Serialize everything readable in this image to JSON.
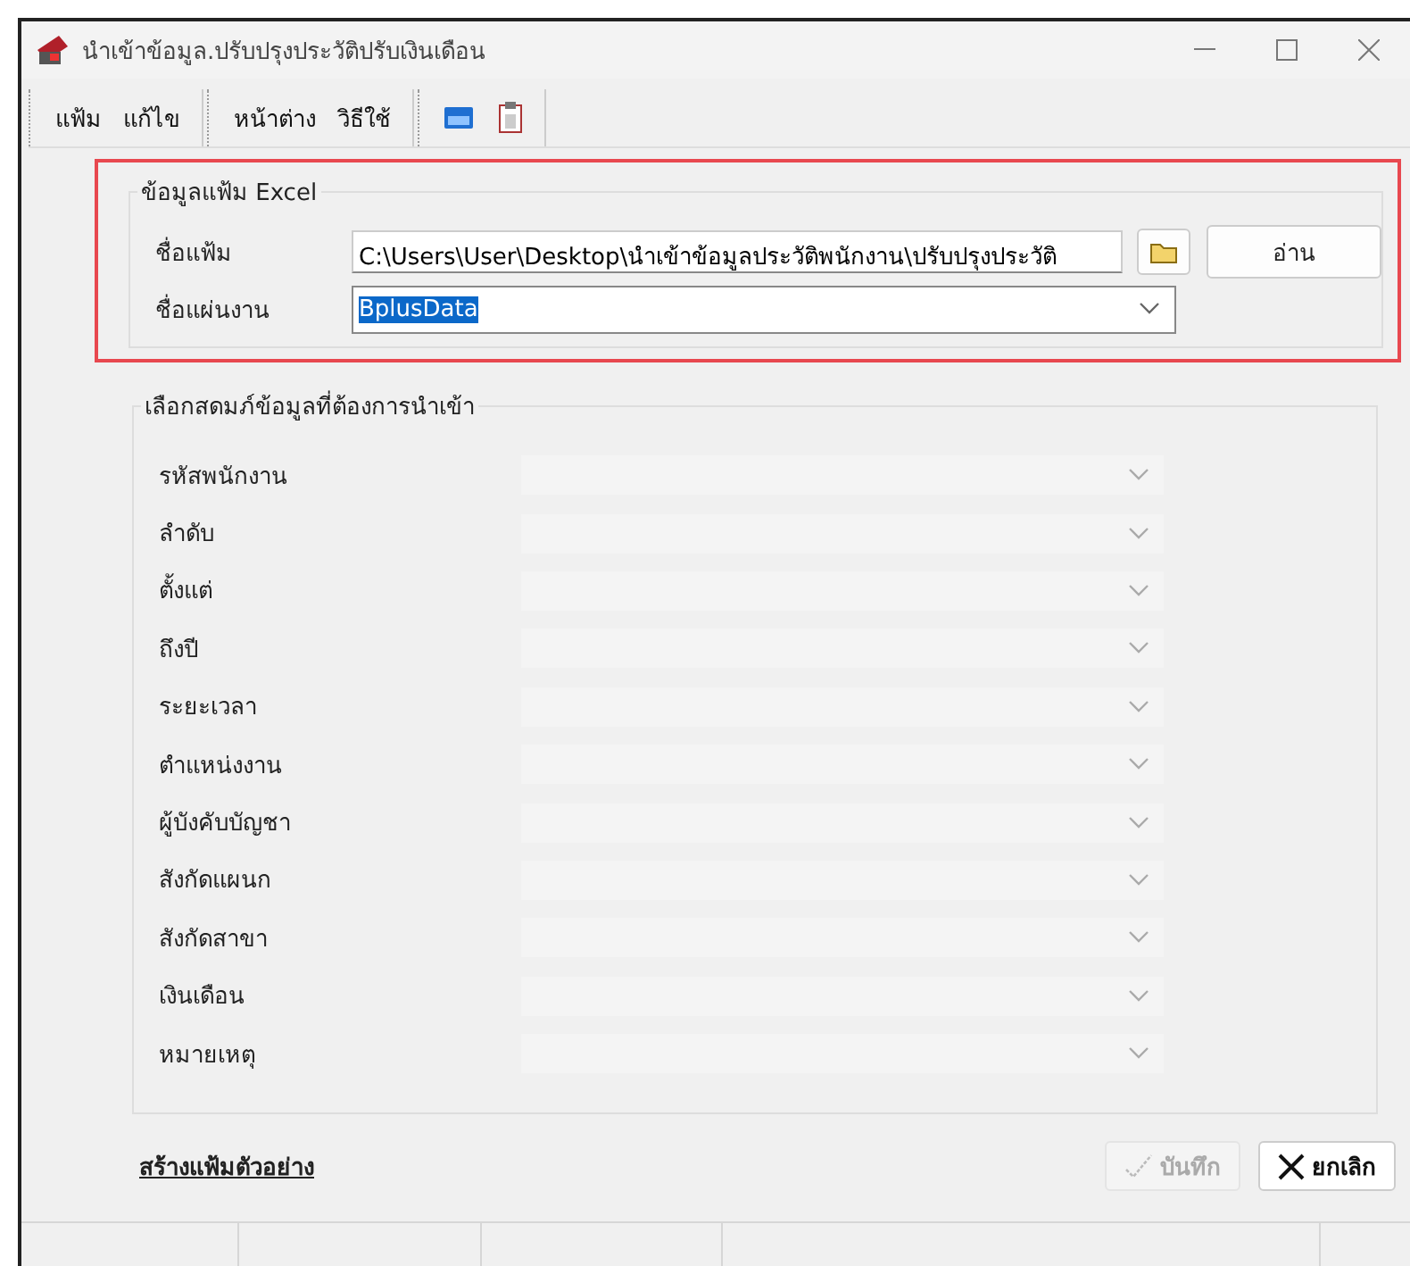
{
  "window": {
    "title": "นำเข้าข้อมูล.ปรับปรุงประวัติปรับเงินเดือน"
  },
  "menu": [
    [
      "แฟ้ม",
      "แก้ไข"
    ],
    [
      "หน้าต่าง",
      "วิธีใช้"
    ]
  ],
  "excel_group": {
    "title": "ข้อมูลแฟ้ม Excel",
    "file_label": "ชื่อแฟ้ม",
    "file_value": "C:\\Users\\User\\Desktop\\นำเข้าข้อมูลประวัติพนักงาน\\ปรับปรุงประวัติ",
    "read_button": "อ่าน",
    "sheet_label": "ชื่อแผ่นงาน",
    "sheet_value": "BplusData"
  },
  "columns_group": {
    "title": "เลือกสดมภ์ข้อมูลที่ต้องการนำเข้า",
    "fields": [
      {
        "label": "รหัสพนักงาน",
        "disabled": true
      },
      {
        "label": "ลำดับ",
        "disabled": true
      },
      {
        "label": "ตั้งแต่",
        "disabled": true
      },
      {
        "label": "ถึงปี",
        "disabled": true
      },
      {
        "label": "ระยะเวลา",
        "disabled": true
      },
      {
        "label": "ตำแหน่งงาน",
        "disabled": true
      },
      {
        "label": "ผู้บังคับบัญชา",
        "disabled": true
      },
      {
        "label": "สังกัดแผนก",
        "disabled": true
      },
      {
        "label": "สังกัดสาขา",
        "disabled": true
      },
      {
        "label": "เงินเดือน",
        "disabled": true
      },
      {
        "label": "หมายเหตุ",
        "disabled": true
      }
    ]
  },
  "footer": {
    "link": "สร้างแฟ้มตัวอย่าง",
    "buttons": [
      {
        "kind": "save",
        "label": "บันทึก",
        "disabled": true
      },
      {
        "kind": "cancel",
        "label": "ยกเลิก",
        "disabled": false
      }
    ]
  }
}
